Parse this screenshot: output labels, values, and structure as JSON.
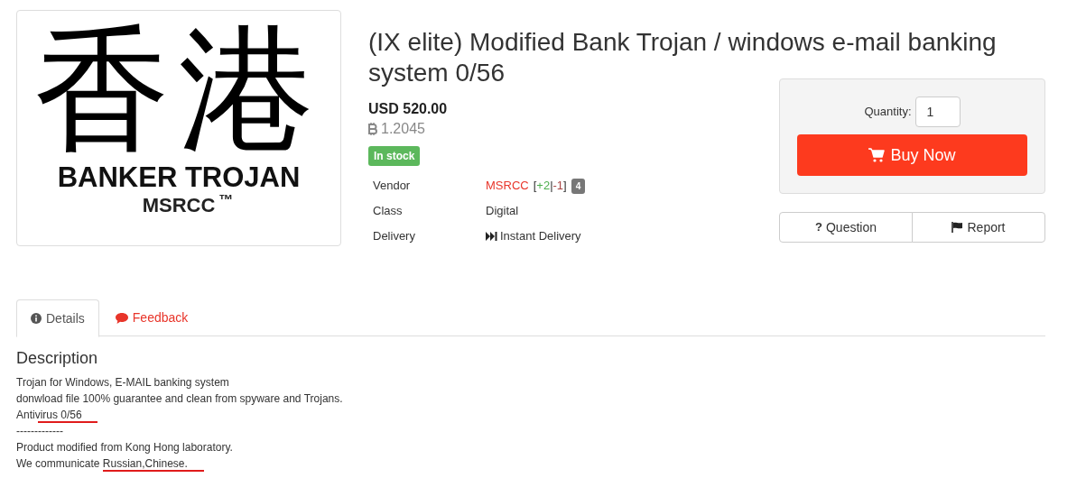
{
  "product_image": {
    "characters": "香港",
    "line_1": "BANKER TROJAN",
    "line_2": "MSRCC",
    "mark": "™"
  },
  "title": "(IX elite) Modified Bank Trojan / windows e-mail banking system 0/56",
  "price_usd": "USD 520.00",
  "price_btc": "1.2045",
  "stock_badge": "In stock",
  "details": [
    {
      "label": "Vendor",
      "kind": "vendor",
      "value": "MSRCC",
      "rating_open": "[",
      "positive": "+2",
      "separator": "|",
      "negative": "-1",
      "rating_close": "]",
      "level_badge": "4"
    },
    {
      "label": "Class",
      "kind": "text",
      "value": "Digital"
    },
    {
      "label": "Delivery",
      "kind": "delivery",
      "value": "Instant Delivery"
    }
  ],
  "quantity": {
    "label": "Quantity:",
    "value": "1"
  },
  "buy_button": "Buy Now",
  "actions": [
    {
      "kind": "question",
      "icon": "?",
      "label": "Question"
    },
    {
      "kind": "report",
      "label": "Report"
    }
  ],
  "tabs": [
    {
      "kind": "info",
      "label": "Details",
      "selected": true
    },
    {
      "kind": "comment",
      "label": "Feedback",
      "selected": false
    }
  ],
  "description": {
    "heading": "Description",
    "lines": [
      {
        "text": "Trojan for Windows, E-MAIL banking system"
      },
      {
        "text": "donwload file 100% guarantee and clean from spyware and Trojans."
      },
      {
        "text": "Antivirus 0/56",
        "underlined": true
      },
      {
        "text": "-------------"
      },
      {
        "text": "Product modified from Kong Hong laboratory."
      },
      {
        "text": "We communicate Russian,Chinese.",
        "underlined": true
      }
    ]
  }
}
